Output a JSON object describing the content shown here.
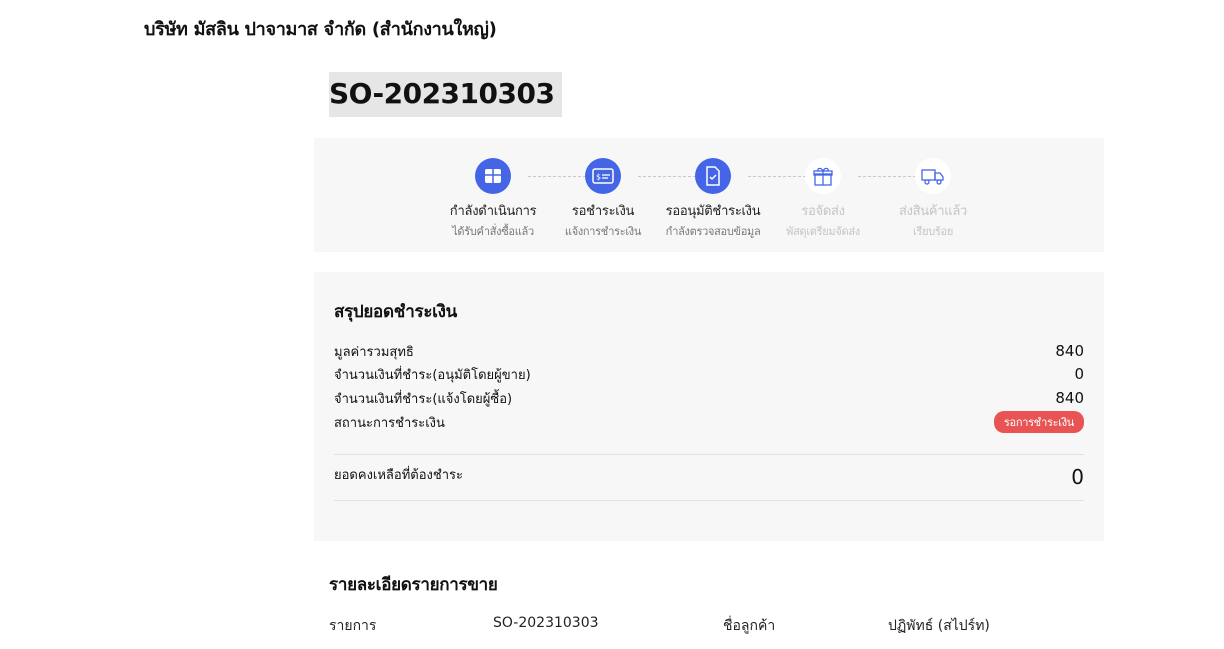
{
  "company_name": "บริษัท มัสลิน ปาจามาส จำกัด (สำนักงานใหญ่)",
  "order_id": "SO-202310303",
  "steps": [
    {
      "title": "กำลังดำเนินการ",
      "subtitle": "ได้รับคำสั่งซื้อแล้ว",
      "state": "active",
      "icon": "box-icon"
    },
    {
      "title": "รอชำระเงิน",
      "subtitle": "แจ้งการชำระเงิน",
      "state": "active",
      "icon": "payment-card-icon"
    },
    {
      "title": "รออนุมัติชำระเงิน",
      "subtitle": "กำลังตรวจสอบข้อมูล",
      "state": "active",
      "icon": "document-check-icon"
    },
    {
      "title": "รอจัดส่ง",
      "subtitle": "พัสดุเตรียมจัดส่ง",
      "state": "inactive",
      "icon": "gift-box-icon"
    },
    {
      "title": "ส่งสินค้าแล้ว",
      "subtitle": "เรียบร้อย",
      "state": "inactive",
      "icon": "truck-icon"
    }
  ],
  "summary": {
    "title": "สรุปยอดชำระเงิน",
    "rows": [
      {
        "label": "มูลค่ารวมสุทธิ",
        "value": "840"
      },
      {
        "label": "จำนวนเงินที่ชำระ(อนุมัติโดยผู้ขาย)",
        "value": "0"
      },
      {
        "label": "จำนวนเงินที่ชำระ(แจ้งโดยผู้ซื้อ)",
        "value": "840"
      }
    ],
    "status_label": "สถานะการชำระเงิน",
    "status_badge": "รอการชำระเงิน",
    "remaining_label": "ยอดคงเหลือที่ต้องชำระ",
    "remaining_value": "0"
  },
  "details": {
    "title": "รายละเอียดรายการขาย",
    "item_label": "รายการ",
    "item_value": "SO-202310303",
    "customer_label": "ชื่อลูกค้า",
    "customer_value": "ปฏิพัทธ์ (สไปร์ท)"
  },
  "colors": {
    "accent": "#4466e6",
    "status_badge": "#e85454",
    "panel_bg": "#f7f7f7"
  }
}
